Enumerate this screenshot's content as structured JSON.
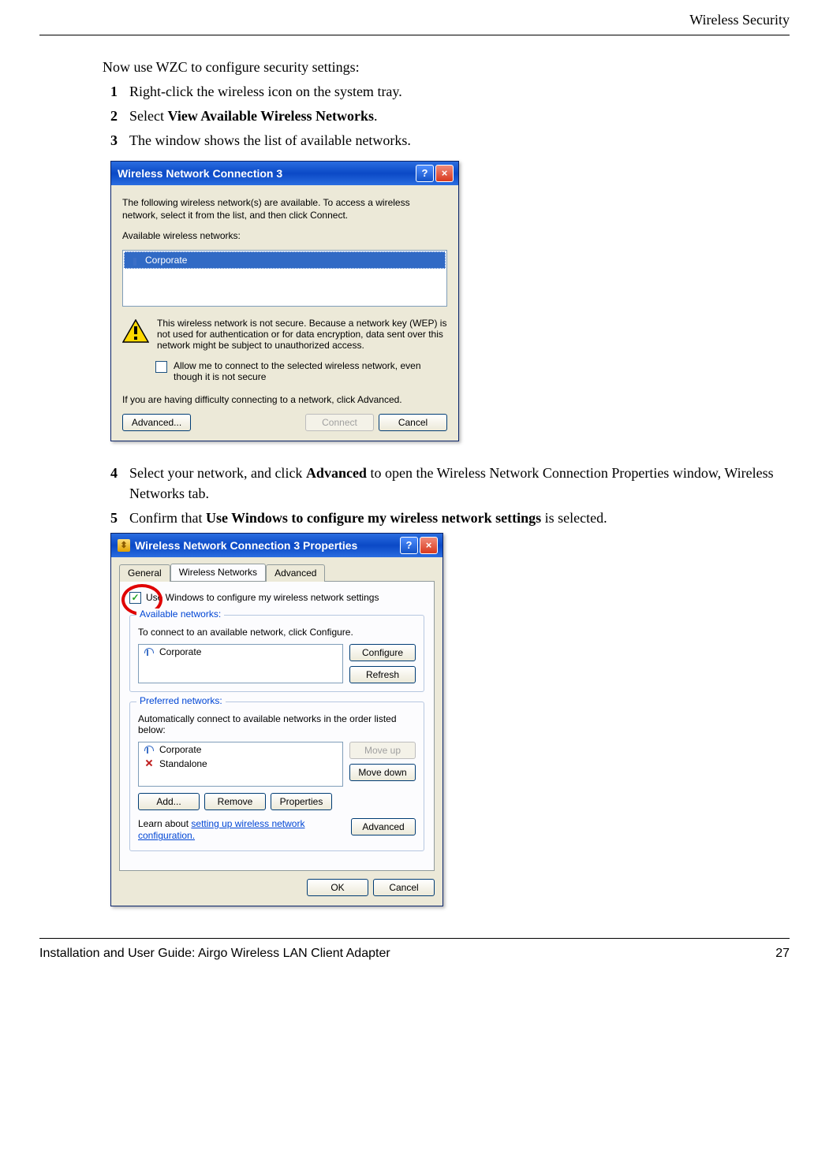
{
  "header": {
    "section": "Wireless Security"
  },
  "intro": "Now use WZC to configure security settings:",
  "steps": [
    {
      "num": "1",
      "text": "Right-click the wireless icon on the system tray."
    },
    {
      "num": "2",
      "pre": "Select ",
      "bold": "View Available Wireless Networks",
      "post": "."
    },
    {
      "num": "3",
      "text": "The window shows the list of available networks."
    }
  ],
  "dialog1": {
    "title": "Wireless Network Connection 3",
    "desc": "The following wireless network(s) are available. To access a wireless network, select it from the list, and then click Connect.",
    "avail_label": "Available wireless networks:",
    "network": "Corporate",
    "warning": "This wireless network is not secure. Because a network key (WEP) is not used for authentication or for data encryption, data sent over this network might be subject to unauthorized access.",
    "allow": "Allow me to connect to the selected wireless network, even though it is not secure",
    "difficulty": "If you are having difficulty connecting to a network, click Advanced.",
    "buttons": {
      "advanced": "Advanced...",
      "connect": "Connect",
      "cancel": "Cancel"
    }
  },
  "steps2": [
    {
      "num": "4",
      "pre": "Select your network, and click ",
      "bold": "Advanced",
      "post": " to open the Wireless Network Connection Properties window, Wireless Networks tab."
    },
    {
      "num": "5",
      "pre": "Confirm that ",
      "bold": "Use Windows to configure my wireless network settings",
      "post": " is selected."
    }
  ],
  "dialog2": {
    "title": "Wireless Network Connection 3 Properties",
    "tabs": {
      "general": "General",
      "wireless": "Wireless Networks",
      "advanced": "Advanced"
    },
    "use_windows": "Use Windows to configure my wireless network settings",
    "group_avail": {
      "title": "Available networks:",
      "desc": "To connect to an available network, click Configure.",
      "item": "Corporate",
      "configure": "Configure",
      "refresh": "Refresh"
    },
    "group_pref": {
      "title": "Preferred networks:",
      "desc": "Automatically connect to available networks in the order listed below:",
      "items": [
        "Corporate",
        "Standalone"
      ],
      "move_up": "Move up",
      "move_down": "Move down",
      "add": "Add...",
      "remove": "Remove",
      "properties": "Properties"
    },
    "learn_pre": "Learn about ",
    "learn_link": "setting up wireless network configuration.",
    "advanced_btn": "Advanced",
    "ok": "OK",
    "cancel": "Cancel"
  },
  "footer": {
    "left": "Installation and User Guide: Airgo Wireless LAN Client Adapter",
    "right": "27"
  }
}
